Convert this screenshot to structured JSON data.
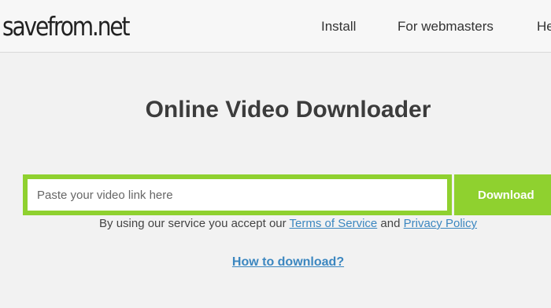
{
  "header": {
    "logo_text": "savefrom.net",
    "nav": [
      {
        "label": "Install"
      },
      {
        "label": "For webmasters"
      },
      {
        "label": "He"
      }
    ]
  },
  "main": {
    "title": "Online Video Downloader",
    "search": {
      "placeholder": "Paste your video link here",
      "value": ""
    },
    "download_label": "Download",
    "terms": {
      "prefix": "By using our service you accept our",
      "tos_label": "Terms of Service",
      "and_text": "and",
      "privacy_label": "Privacy Policy"
    },
    "how_to_label": "How to download?"
  },
  "colors": {
    "accent": "#8fd12f",
    "link": "#3c87c0",
    "background": "#f2f2f2"
  }
}
